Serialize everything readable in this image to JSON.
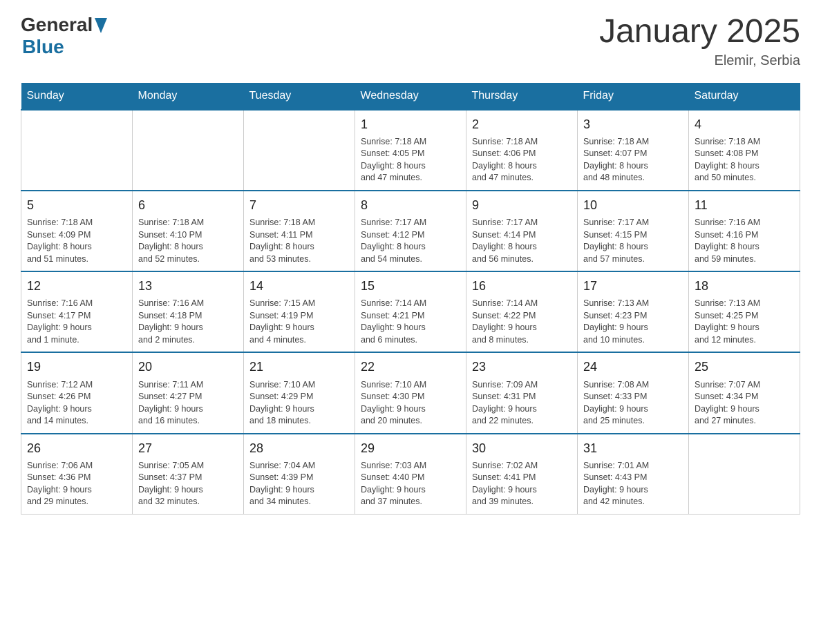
{
  "header": {
    "logo_general": "General",
    "logo_blue": "Blue",
    "title": "January 2025",
    "location": "Elemir, Serbia"
  },
  "days_of_week": [
    "Sunday",
    "Monday",
    "Tuesday",
    "Wednesday",
    "Thursday",
    "Friday",
    "Saturday"
  ],
  "weeks": [
    [
      {
        "day": "",
        "info": ""
      },
      {
        "day": "",
        "info": ""
      },
      {
        "day": "",
        "info": ""
      },
      {
        "day": "1",
        "info": "Sunrise: 7:18 AM\nSunset: 4:05 PM\nDaylight: 8 hours\nand 47 minutes."
      },
      {
        "day": "2",
        "info": "Sunrise: 7:18 AM\nSunset: 4:06 PM\nDaylight: 8 hours\nand 47 minutes."
      },
      {
        "day": "3",
        "info": "Sunrise: 7:18 AM\nSunset: 4:07 PM\nDaylight: 8 hours\nand 48 minutes."
      },
      {
        "day": "4",
        "info": "Sunrise: 7:18 AM\nSunset: 4:08 PM\nDaylight: 8 hours\nand 50 minutes."
      }
    ],
    [
      {
        "day": "5",
        "info": "Sunrise: 7:18 AM\nSunset: 4:09 PM\nDaylight: 8 hours\nand 51 minutes."
      },
      {
        "day": "6",
        "info": "Sunrise: 7:18 AM\nSunset: 4:10 PM\nDaylight: 8 hours\nand 52 minutes."
      },
      {
        "day": "7",
        "info": "Sunrise: 7:18 AM\nSunset: 4:11 PM\nDaylight: 8 hours\nand 53 minutes."
      },
      {
        "day": "8",
        "info": "Sunrise: 7:17 AM\nSunset: 4:12 PM\nDaylight: 8 hours\nand 54 minutes."
      },
      {
        "day": "9",
        "info": "Sunrise: 7:17 AM\nSunset: 4:14 PM\nDaylight: 8 hours\nand 56 minutes."
      },
      {
        "day": "10",
        "info": "Sunrise: 7:17 AM\nSunset: 4:15 PM\nDaylight: 8 hours\nand 57 minutes."
      },
      {
        "day": "11",
        "info": "Sunrise: 7:16 AM\nSunset: 4:16 PM\nDaylight: 8 hours\nand 59 minutes."
      }
    ],
    [
      {
        "day": "12",
        "info": "Sunrise: 7:16 AM\nSunset: 4:17 PM\nDaylight: 9 hours\nand 1 minute."
      },
      {
        "day": "13",
        "info": "Sunrise: 7:16 AM\nSunset: 4:18 PM\nDaylight: 9 hours\nand 2 minutes."
      },
      {
        "day": "14",
        "info": "Sunrise: 7:15 AM\nSunset: 4:19 PM\nDaylight: 9 hours\nand 4 minutes."
      },
      {
        "day": "15",
        "info": "Sunrise: 7:14 AM\nSunset: 4:21 PM\nDaylight: 9 hours\nand 6 minutes."
      },
      {
        "day": "16",
        "info": "Sunrise: 7:14 AM\nSunset: 4:22 PM\nDaylight: 9 hours\nand 8 minutes."
      },
      {
        "day": "17",
        "info": "Sunrise: 7:13 AM\nSunset: 4:23 PM\nDaylight: 9 hours\nand 10 minutes."
      },
      {
        "day": "18",
        "info": "Sunrise: 7:13 AM\nSunset: 4:25 PM\nDaylight: 9 hours\nand 12 minutes."
      }
    ],
    [
      {
        "day": "19",
        "info": "Sunrise: 7:12 AM\nSunset: 4:26 PM\nDaylight: 9 hours\nand 14 minutes."
      },
      {
        "day": "20",
        "info": "Sunrise: 7:11 AM\nSunset: 4:27 PM\nDaylight: 9 hours\nand 16 minutes."
      },
      {
        "day": "21",
        "info": "Sunrise: 7:10 AM\nSunset: 4:29 PM\nDaylight: 9 hours\nand 18 minutes."
      },
      {
        "day": "22",
        "info": "Sunrise: 7:10 AM\nSunset: 4:30 PM\nDaylight: 9 hours\nand 20 minutes."
      },
      {
        "day": "23",
        "info": "Sunrise: 7:09 AM\nSunset: 4:31 PM\nDaylight: 9 hours\nand 22 minutes."
      },
      {
        "day": "24",
        "info": "Sunrise: 7:08 AM\nSunset: 4:33 PM\nDaylight: 9 hours\nand 25 minutes."
      },
      {
        "day": "25",
        "info": "Sunrise: 7:07 AM\nSunset: 4:34 PM\nDaylight: 9 hours\nand 27 minutes."
      }
    ],
    [
      {
        "day": "26",
        "info": "Sunrise: 7:06 AM\nSunset: 4:36 PM\nDaylight: 9 hours\nand 29 minutes."
      },
      {
        "day": "27",
        "info": "Sunrise: 7:05 AM\nSunset: 4:37 PM\nDaylight: 9 hours\nand 32 minutes."
      },
      {
        "day": "28",
        "info": "Sunrise: 7:04 AM\nSunset: 4:39 PM\nDaylight: 9 hours\nand 34 minutes."
      },
      {
        "day": "29",
        "info": "Sunrise: 7:03 AM\nSunset: 4:40 PM\nDaylight: 9 hours\nand 37 minutes."
      },
      {
        "day": "30",
        "info": "Sunrise: 7:02 AM\nSunset: 4:41 PM\nDaylight: 9 hours\nand 39 minutes."
      },
      {
        "day": "31",
        "info": "Sunrise: 7:01 AM\nSunset: 4:43 PM\nDaylight: 9 hours\nand 42 minutes."
      },
      {
        "day": "",
        "info": ""
      }
    ]
  ]
}
